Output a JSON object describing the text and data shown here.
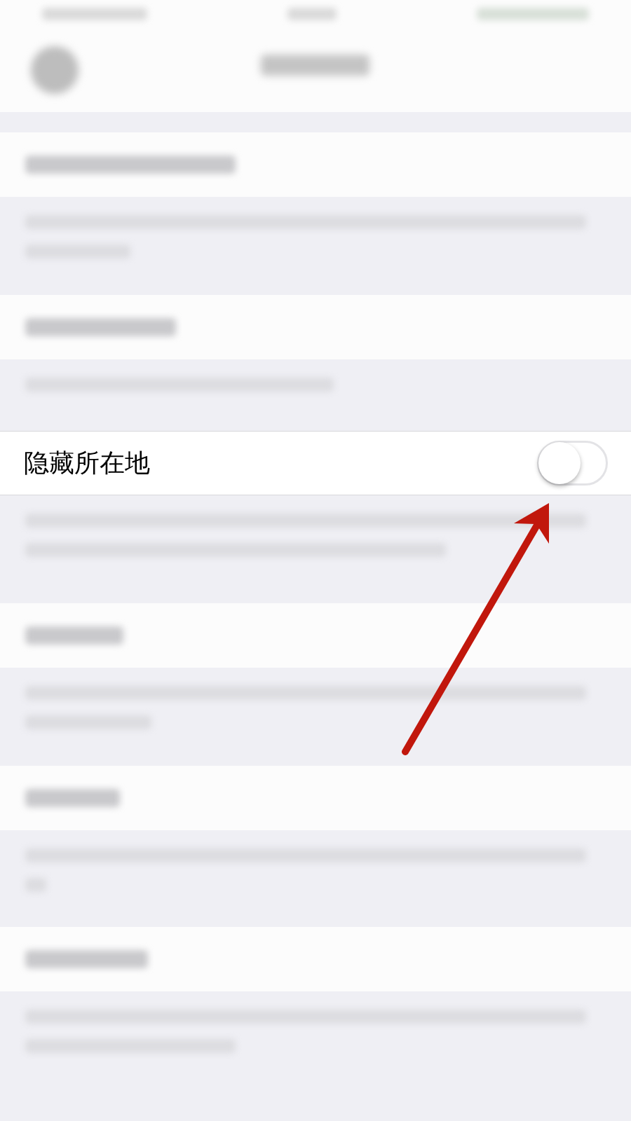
{
  "setting": {
    "label": "隐藏所在地",
    "on": false
  }
}
